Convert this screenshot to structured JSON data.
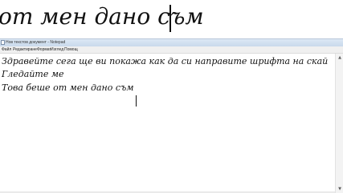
{
  "zoomed_text": "от мен дано съм",
  "window": {
    "title": "Нов текстов документ - Notepad"
  },
  "menu": {
    "items": [
      {
        "label": "Файл"
      },
      {
        "label": "Редактиране"
      },
      {
        "label": "Формат"
      },
      {
        "label": "Изглед"
      },
      {
        "label": "Помощ"
      }
    ]
  },
  "editor": {
    "lines": [
      "Здравейте сега ще ви покажа как да си направите шрифта на скай",
      "Гледайте ме",
      "Това беше от мен дано съм"
    ]
  },
  "icons": {
    "app_icon": "notepad-icon",
    "scroll_up": "arrow-up-icon",
    "scroll_down": "arrow-down-icon"
  }
}
